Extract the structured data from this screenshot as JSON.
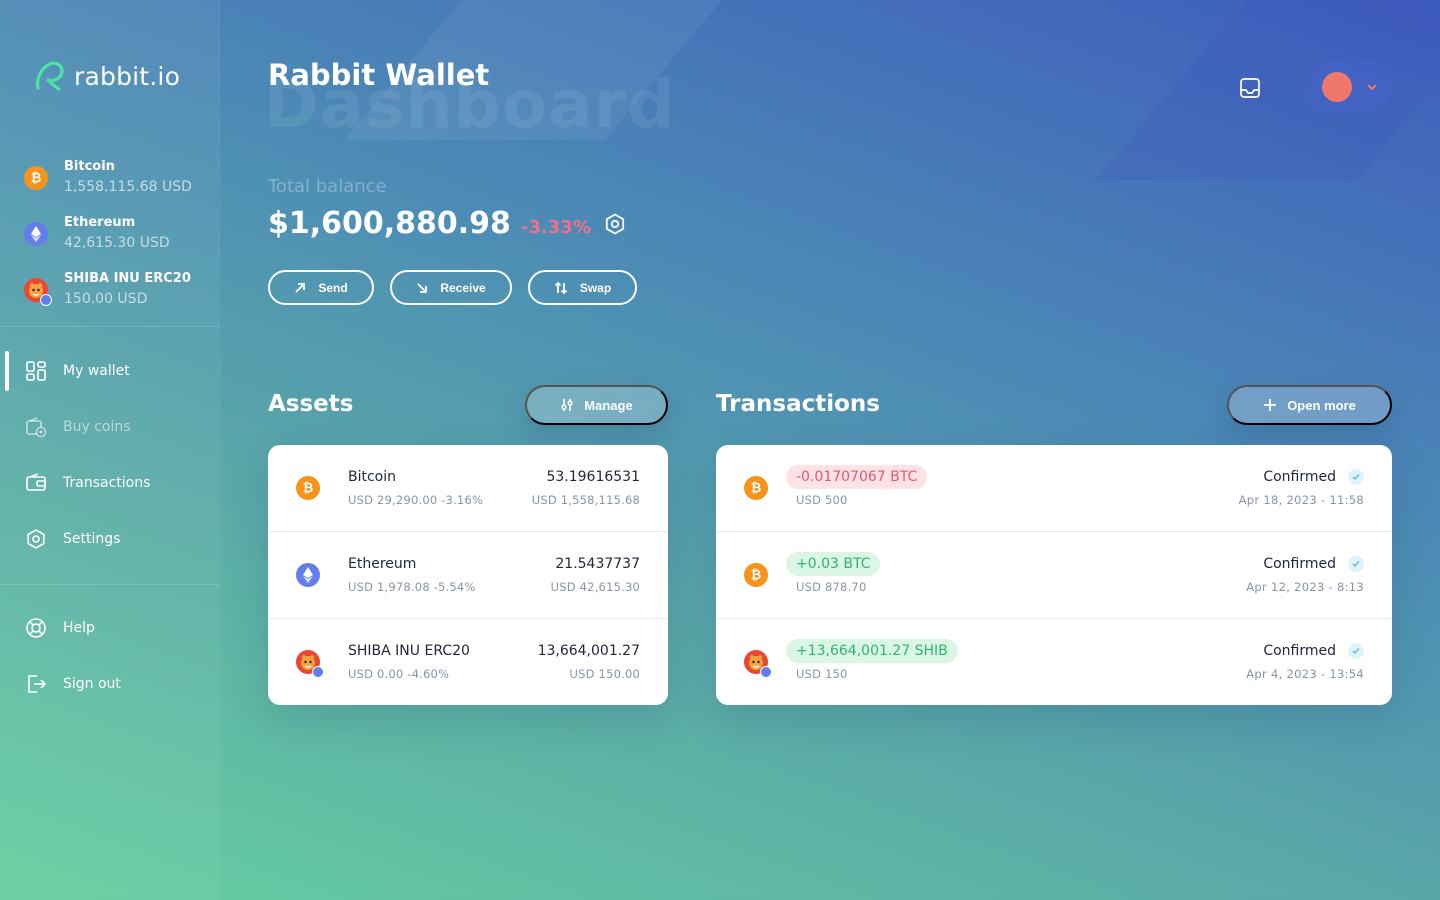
{
  "app": {
    "logo_text": "rabbit.io",
    "title": "Rabbit Wallet",
    "ghost_title": "Dashboard"
  },
  "sidebar": {
    "coins": [
      {
        "name": "Bitcoin",
        "usd": "1,558,115.68 USD",
        "icon": "bitcoin-icon"
      },
      {
        "name": "Ethereum",
        "usd": "42,615.30 USD",
        "icon": "ethereum-icon"
      },
      {
        "name": "SHIBA INU ERC20",
        "usd": "150.00 USD",
        "icon": "shiba-inu-icon"
      }
    ],
    "nav": [
      {
        "label": "My wallet",
        "icon": "grid-icon",
        "active": true
      },
      {
        "label": "Buy coins",
        "icon": "wallet-plus-icon",
        "muted": true
      },
      {
        "label": "Transactions",
        "icon": "wallet-icon"
      },
      {
        "label": "Settings",
        "icon": "gear-icon"
      }
    ],
    "footer_nav": [
      {
        "label": "Help",
        "icon": "lifebuoy-icon"
      },
      {
        "label": "Sign out",
        "icon": "sign-out-icon"
      }
    ]
  },
  "balance": {
    "label": "Total balance",
    "value": "$1,600,880.98",
    "change": "-3.33%"
  },
  "actions": {
    "send": "Send",
    "receive": "Receive",
    "swap": "Swap"
  },
  "assets": {
    "title": "Assets",
    "manage_label": "Manage",
    "rows": [
      {
        "name": "Bitcoin",
        "sub": "USD 29,290.00 -3.16%",
        "amount": "53.19616531",
        "usd": "USD 1,558,115.68"
      },
      {
        "name": "Ethereum",
        "sub": "USD 1,978.08 -5.54%",
        "amount": "21.5437737",
        "usd": "USD 42,615.30"
      },
      {
        "name": "SHIBA INU ERC20",
        "sub": "USD 0.00 -4.60%",
        "amount": "13,664,001.27",
        "usd": "USD 150.00"
      }
    ]
  },
  "transactions": {
    "title": "Transactions",
    "open_more_label": "Open more",
    "rows": [
      {
        "amount": "-0.01707067 BTC",
        "usd": "USD 500",
        "status": "Confirmed",
        "date": "Apr 18, 2023 - 11:58"
      },
      {
        "amount": "+0.03 BTC",
        "usd": "USD 878.70",
        "status": "Confirmed",
        "date": "Apr 12, 2023 - 8:13"
      },
      {
        "amount": "+13,664,001.27 SHIB",
        "usd": "USD 150",
        "status": "Confirmed",
        "date": "Apr 4, 2023 - 13:54"
      }
    ]
  },
  "colors": {
    "bitcoin": "#f7931a",
    "ethereum": "#627eea",
    "negative": "#e8576f",
    "positive": "#2cb670",
    "avatar": "#f0786a"
  }
}
